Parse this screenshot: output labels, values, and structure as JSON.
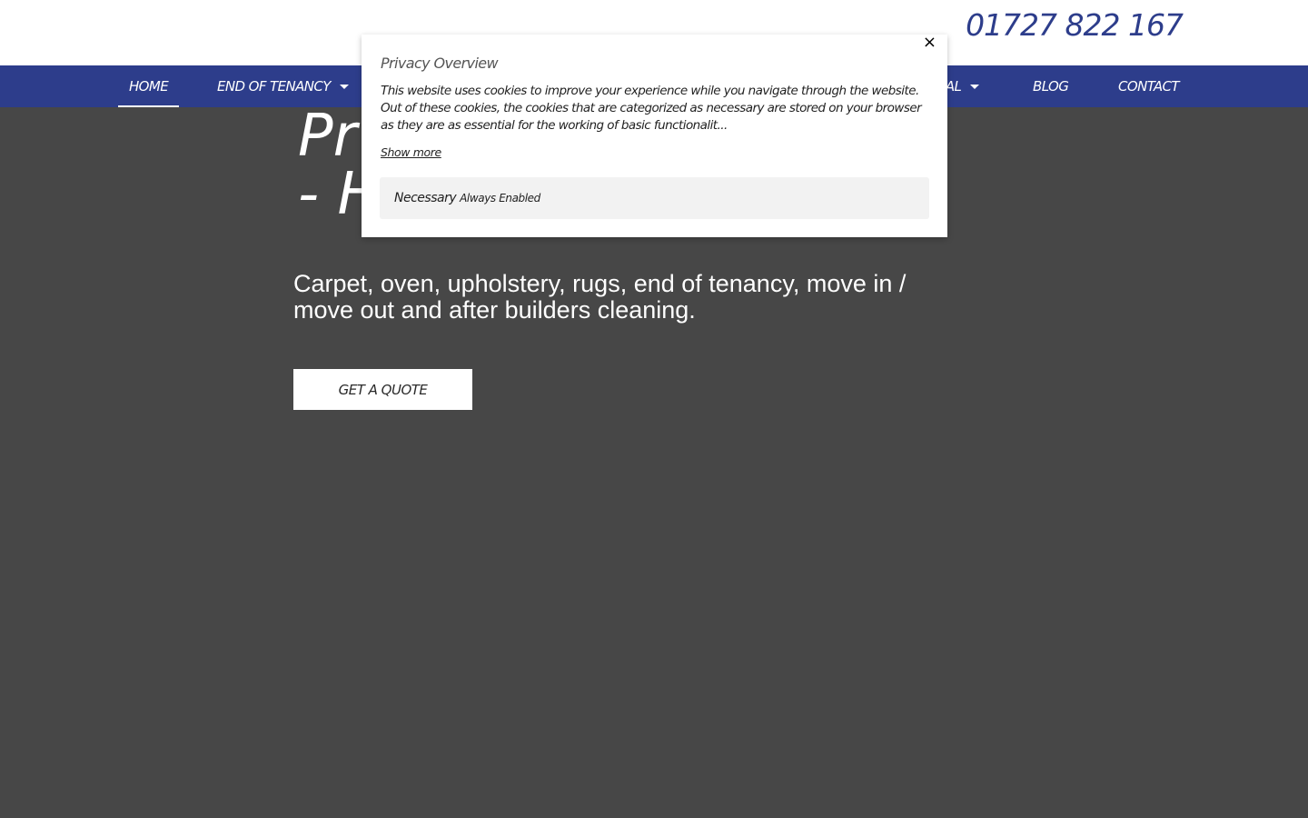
{
  "header": {
    "phone": "01727 822 167"
  },
  "nav": {
    "items": [
      {
        "label": "HOME",
        "active": true,
        "has_dropdown": false
      },
      {
        "label": "END OF TENANCY",
        "active": false,
        "has_dropdown": true
      },
      {
        "label": "IAL",
        "active": false,
        "has_dropdown": true
      },
      {
        "label": "BLOG",
        "active": false,
        "has_dropdown": false
      },
      {
        "label": "CONTACT",
        "active": false,
        "has_dropdown": false
      }
    ]
  },
  "hero": {
    "title_line1": "Pr",
    "title_line2": "- H",
    "subtitle": "Carpet, oven, upholstery, rugs, end of tenancy, move in / move out and after builders cleaning.",
    "cta_label": "GET A QUOTE"
  },
  "privacy_modal": {
    "close_glyph": "×",
    "title": "Privacy Overview",
    "body": "This website uses cookies to improve your experience while you navigate through the website. Out of these cookies, the cookies that are categorized as necessary are stored on your browser as they are as essential for the working of basic functionalit...",
    "show_more": "Show more",
    "necessary_label": "Necessary",
    "always_enabled": "Always Enabled"
  },
  "colors": {
    "brand_blue": "#2d3d8b",
    "hero_overlay": "#474747",
    "necessary_bg": "#f2f2f2"
  }
}
